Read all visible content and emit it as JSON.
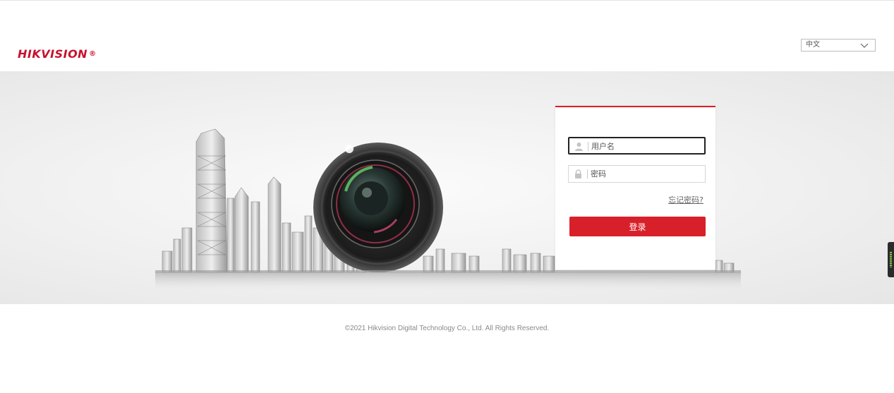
{
  "header": {
    "logo_text_bold": "HIK",
    "logo_text_rest": "VISION",
    "logo_mark": "®",
    "language": {
      "selected": "中文",
      "icon": "chevron-down-icon"
    }
  },
  "login": {
    "username": {
      "placeholder": "用户名",
      "value": "",
      "icon": "user-icon"
    },
    "password": {
      "placeholder": "密码",
      "value": "",
      "icon": "lock-icon"
    },
    "forgot_label": "忘记密码?",
    "submit_label": "登录"
  },
  "footer": {
    "copyright": "©2021 Hikvision Digital Technology Co., Ltd. All Rights Reserved."
  },
  "colors": {
    "brand_red": "#d8202a",
    "logo_red": "#c8102e",
    "band_bg": "#efefef"
  }
}
